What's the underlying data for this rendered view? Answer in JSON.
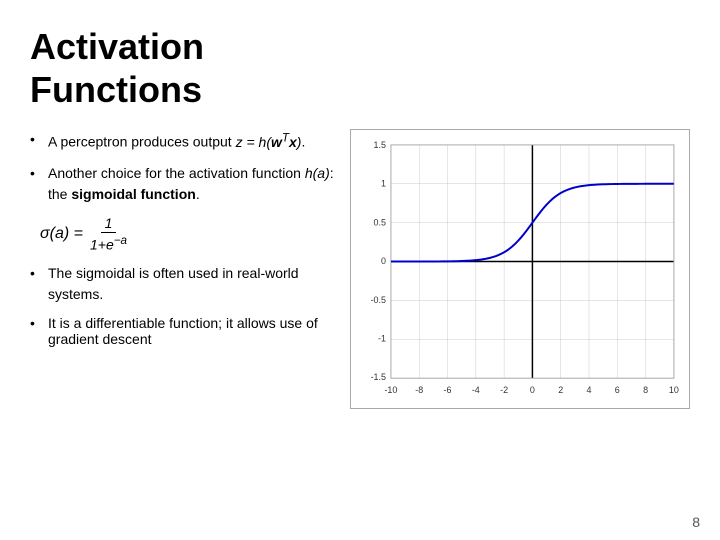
{
  "title": {
    "line1": "Activation",
    "line2": "Functions"
  },
  "bullets": [
    {
      "text_before": "A perceptron produces output ",
      "math": "z = h(w",
      "math_super": "T",
      "math_after": "x).",
      "full": "A perceptron produces output z = h(wᵀx)."
    },
    {
      "text_before": "Another choice for the activation function ",
      "italic_part": "h(a):",
      "text_after": " the ",
      "bold_part": "sigmoidal function",
      "end": ".",
      "full": "Another choice for the activation function h(a): the sigmoidal function."
    }
  ],
  "formula": {
    "lhs": "σ(a) =",
    "numerator": "1",
    "denominator": "1+e⁻ᵃ"
  },
  "bullet3": "The sigmoidal is often used in real-world systems.",
  "bullet4": "It is a differentiable function; it allows use of gradient descent",
  "page_number": "8",
  "graph": {
    "x_min": -10,
    "x_max": 10,
    "y_min": -1.5,
    "y_max": 1.5,
    "x_ticks": [
      -10,
      -8,
      -6,
      -4,
      -2,
      0,
      2,
      4,
      6,
      8,
      10
    ],
    "y_ticks": [
      -1.5,
      -1,
      -0.5,
      0,
      0.5,
      1,
      1.5
    ],
    "curve_color": "#0000cc",
    "axis_color": "#000000"
  }
}
